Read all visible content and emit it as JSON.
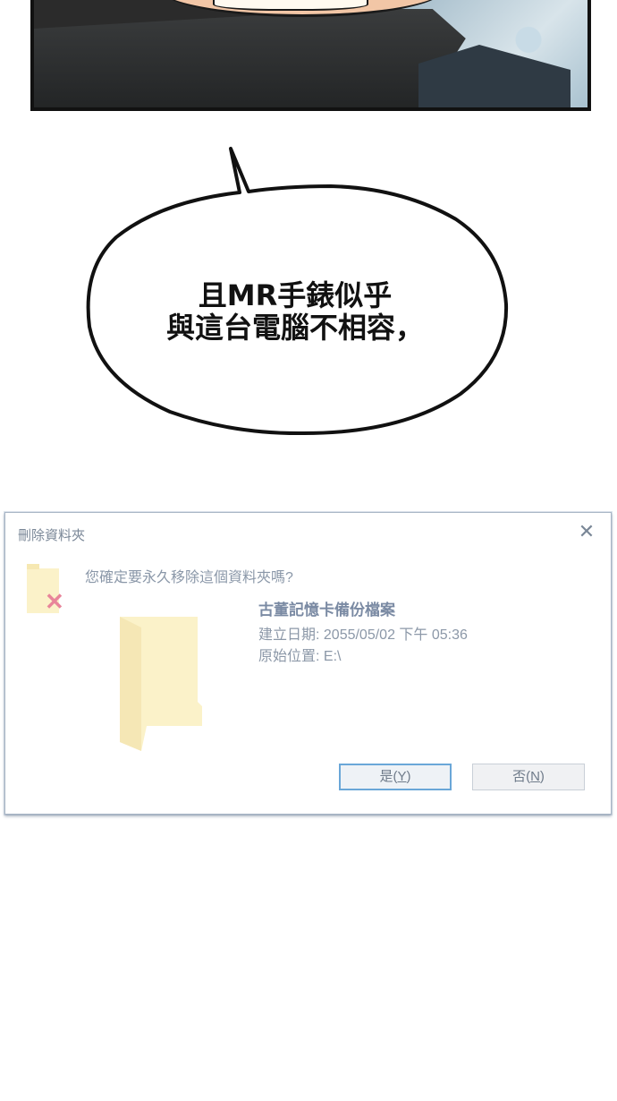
{
  "speech_bubble": {
    "line1": "且MR手錶似乎",
    "line2": "與這台電腦不相容，"
  },
  "dialog": {
    "title": "刪除資料夾",
    "close_symbol": "✕",
    "question": "您確定要永久移除這個資料夾嗎?",
    "item": {
      "name": "古董記憶卡備份檔案",
      "created": "建立日期: 2055/05/02 下午 05:36",
      "location": "原始位置: E:\\"
    },
    "buttons": {
      "yes_label": "是(",
      "yes_key": "Y",
      "yes_close": ")",
      "no_label": "否(",
      "no_key": "N",
      "no_close": ")"
    }
  },
  "colors": {
    "folder": "#fbf2c9",
    "delete_x": "#e8859a",
    "accent_border": "#6aa7d8"
  }
}
